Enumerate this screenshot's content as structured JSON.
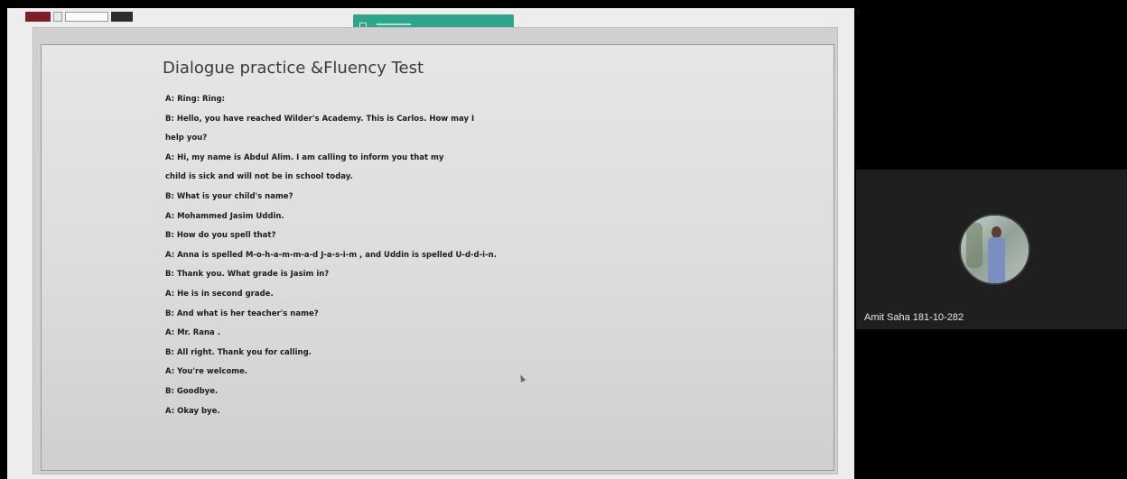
{
  "slide": {
    "title": "Dialogue practice &Fluency Test",
    "lines": [
      "A: Ring: Ring:",
      "B: Hello, you have reached Wilder's Academy. This is Carlos. How may I",
      "help you?",
      "A: Hi, my name is Abdul Alim. I am calling to inform you that my",
      "child is sick and will not be in school today.",
      "B: What is your child's name?",
      "A: Mohammed Jasim Uddin.",
      "B: How do you spell that?",
      "A: Anna is spelled M-o-h-a-m-m-a-d  J-a-s-i-m , and Uddin is spelled U-d-d-i-n.",
      "B: Thank you. What grade is Jasim in?",
      "A: He is in second grade.",
      "B: And what is her teacher's name?",
      "A: Mr. Rana .",
      "B: All right. Thank you for calling.",
      "A: You're welcome.",
      "B: Goodbye.",
      "A: Okay bye."
    ]
  },
  "notification": {
    "icon": "share-screen-icon",
    "color": "#2fa58d"
  },
  "participant": {
    "name": "Amit Saha 181-10-282",
    "avatar": "avatar"
  },
  "colors": {
    "background": "#000000",
    "slide_background": "#e2e2e2",
    "notification": "#2fa58d",
    "tile": "#1f1f1f"
  }
}
